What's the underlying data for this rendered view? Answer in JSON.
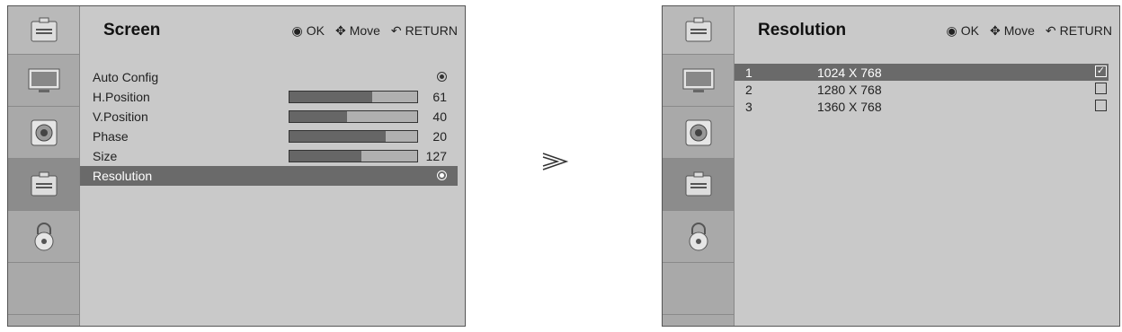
{
  "left": {
    "title": "Screen",
    "hints": {
      "ok": "OK",
      "move": "Move",
      "return": "RETURN"
    },
    "items": [
      {
        "label": "Auto Config",
        "type": "radio"
      },
      {
        "label": "H.Position",
        "type": "bar",
        "value": "61",
        "fill": 0.65
      },
      {
        "label": "V.Position",
        "type": "bar",
        "value": "40",
        "fill": 0.45
      },
      {
        "label": "Phase",
        "type": "bar",
        "value": "20",
        "fill": 0.75
      },
      {
        "label": "Size",
        "type": "bar",
        "value": "127",
        "fill": 0.56
      },
      {
        "label": "Resolution",
        "type": "radio",
        "selected": true
      }
    ]
  },
  "right": {
    "title": "Resolution",
    "hints": {
      "ok": "OK",
      "move": "Move",
      "return": "RETURN"
    },
    "options": [
      {
        "index": "1",
        "value": "1024 X 768",
        "checked": true
      },
      {
        "index": "2",
        "value": "1280 X 768",
        "checked": false
      },
      {
        "index": "3",
        "value": "1360 X 768",
        "checked": false
      }
    ]
  },
  "arrow": ">",
  "sidebar_icons": [
    "screen-tools-icon",
    "monitor-icon",
    "speaker-icon",
    "screen-tools-icon",
    "lock-icon"
  ]
}
